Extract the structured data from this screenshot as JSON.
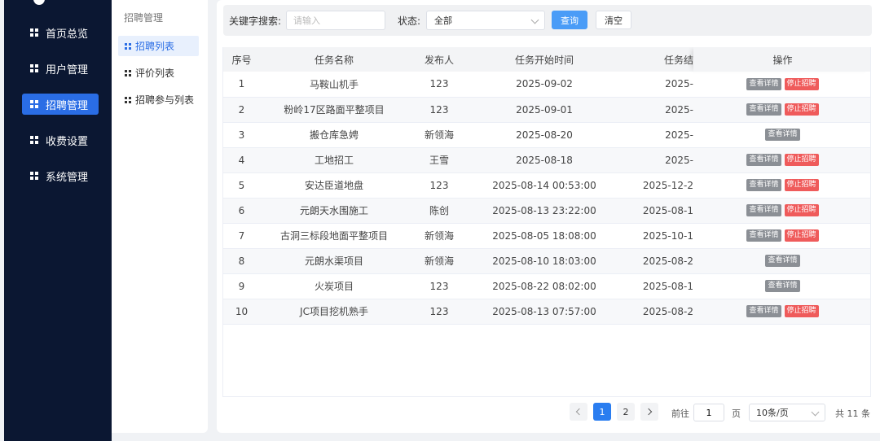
{
  "sidebar": {
    "items": [
      {
        "label": "首页总览",
        "active": false
      },
      {
        "label": "用户管理",
        "active": false
      },
      {
        "label": "招聘管理",
        "active": true
      },
      {
        "label": "收费设置",
        "active": false
      },
      {
        "label": "系统管理",
        "active": false
      }
    ]
  },
  "submenu": {
    "title": "招聘管理",
    "items": [
      {
        "label": "招聘列表",
        "active": true
      },
      {
        "label": "评价列表",
        "active": false
      },
      {
        "label": "招聘参与列表",
        "active": false
      }
    ]
  },
  "search": {
    "keyword_label": "关键字搜索:",
    "keyword_placeholder": "请输入",
    "keyword_value": "",
    "status_label": "状态:",
    "status_value": "全部",
    "query_button": "查询",
    "clear_button": "清空"
  },
  "table": {
    "headers": [
      "序号",
      "任务名称",
      "发布人",
      "任务开始时间",
      "任务结",
      "操作"
    ],
    "view_label": "查看详情",
    "stop_label": "停止招聘",
    "rows": [
      {
        "no": "1",
        "name": "马鞍山机手",
        "publisher": "123",
        "start": "2025-09-02",
        "end": "2025-",
        "stop": true
      },
      {
        "no": "2",
        "name": "粉岭17区路面平整项目",
        "publisher": "123",
        "start": "2025-09-01",
        "end": "2025-",
        "stop": true
      },
      {
        "no": "3",
        "name": "搬仓库急娉",
        "publisher": "新领海",
        "start": "2025-08-20",
        "end": "2025-",
        "stop": false
      },
      {
        "no": "4",
        "name": "工地招工",
        "publisher": "王雪",
        "start": "2025-08-18",
        "end": "2025-",
        "stop": true
      },
      {
        "no": "5",
        "name": "安达臣道地盘",
        "publisher": "123",
        "start": "2025-08-14 00:53:00",
        "end": "2025-12-2",
        "stop": true
      },
      {
        "no": "6",
        "name": "元朗天水围施工",
        "publisher": "陈创",
        "start": "2025-08-13 23:22:00",
        "end": "2025-08-1",
        "stop": true
      },
      {
        "no": "7",
        "name": "古洞三标段地面平整项目",
        "publisher": "新领海",
        "start": "2025-08-05 18:08:00",
        "end": "2025-10-1",
        "stop": true
      },
      {
        "no": "8",
        "name": "元朗水渠项目",
        "publisher": "新领海",
        "start": "2025-08-10 18:03:00",
        "end": "2025-08-2",
        "stop": false
      },
      {
        "no": "9",
        "name": "火炭项目",
        "publisher": "123",
        "start": "2025-08-22 08:02:00",
        "end": "2025-08-1",
        "stop": false
      },
      {
        "no": "10",
        "name": "JC项目挖机熟手",
        "publisher": "123",
        "start": "2025-08-13 07:57:00",
        "end": "2025-08-2",
        "stop": true
      }
    ]
  },
  "pagination": {
    "pages": [
      "1",
      "2"
    ],
    "current": "1",
    "goto_label": "前往",
    "goto_value": "1",
    "page_unit": "页",
    "page_size": "10条/页",
    "total": "共 11 条"
  },
  "colors": {
    "sidebar_bg": "#0b1732",
    "accent": "#2a6de5",
    "stop_button": "#ef5b5b",
    "view_button": "#8b8f95"
  }
}
